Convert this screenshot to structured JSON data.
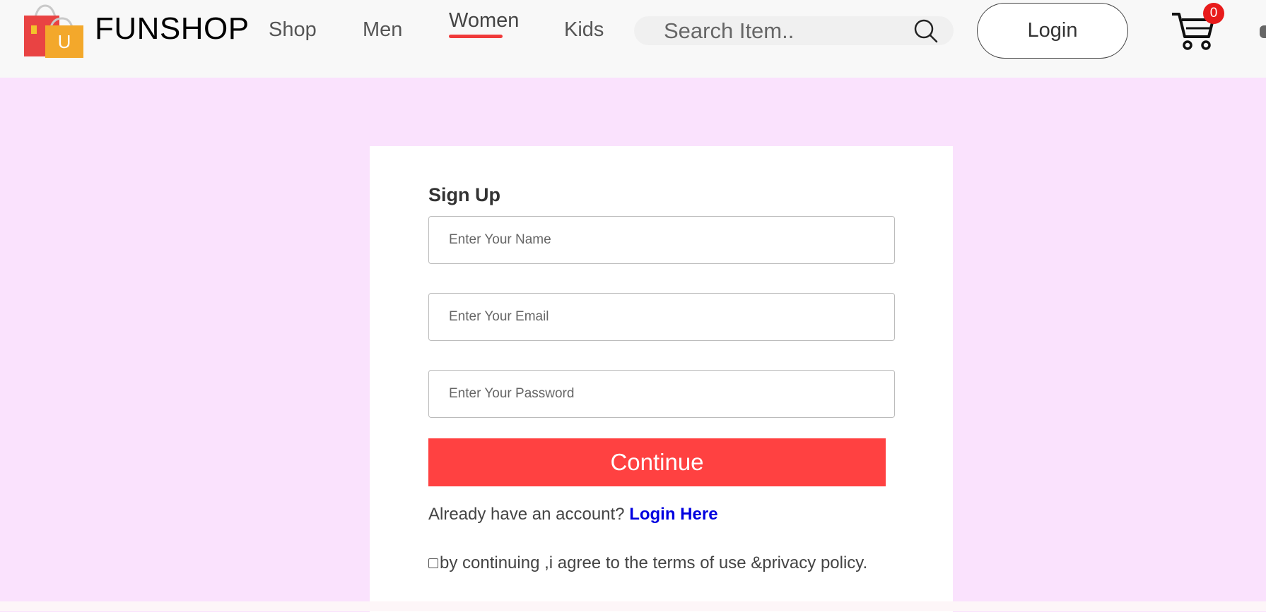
{
  "header": {
    "brand": "FUNSHOP",
    "logo_letter": "U",
    "nav": [
      "Shop",
      "Men",
      "Women",
      "Kids"
    ],
    "active_nav": "Women",
    "search_placeholder": "Search Item..",
    "login_label": "Login",
    "cart_count": "0",
    "icons": [
      "shopping-bag-logo",
      "search-icon",
      "cart-icon"
    ]
  },
  "signup": {
    "title": "Sign Up",
    "name_placeholder": "Enter Your Name",
    "email_placeholder": "Enter Your Email",
    "password_placeholder": "Enter Your Password",
    "continue_label": "Continue",
    "already_text": "Already have an account? ",
    "login_link": "Login Here",
    "terms_text": "by continuing ,i agree to the terms of use &privacy policy."
  },
  "colors": {
    "page_bg": "#fae2fd",
    "header_bg": "#f8f8f8",
    "accent_red": "#ff4141",
    "link_blue": "#0000e0",
    "badge_red": "#e81b1b"
  }
}
